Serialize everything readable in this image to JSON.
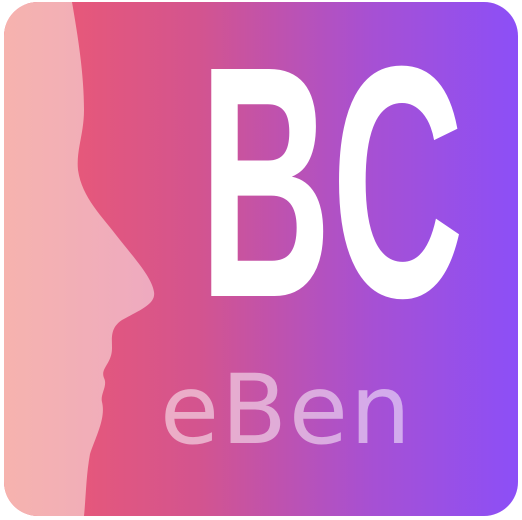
{
  "logo": {
    "primary_text": "BC",
    "secondary_text": "eBen",
    "colors": {
      "gradient_start": "#f15a6e",
      "gradient_mid": "#d3548f",
      "gradient_end": "#8c4ff7",
      "profile_fill": "#f5b0b5",
      "text_primary": "#ffffff"
    },
    "graphic": "human-profile-silhouette"
  }
}
